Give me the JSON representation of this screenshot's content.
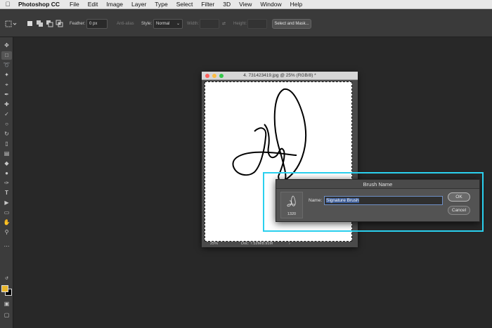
{
  "menubar": {
    "apple": "",
    "app_name": "Photoshop CC",
    "items": [
      "File",
      "Edit",
      "Image",
      "Layer",
      "Type",
      "Select",
      "Filter",
      "3D",
      "View",
      "Window",
      "Help"
    ]
  },
  "options_bar": {
    "feather_label": "Feather:",
    "feather_value": "0 px",
    "anti_alias_label": "Anti-alias",
    "style_label": "Style:",
    "style_value": "Normal",
    "width_label": "Width:",
    "height_label": "Height:",
    "select_mask_label": "Select and Mask..."
  },
  "document": {
    "title": "4. 731423419.jpg @ 25% (RGB/8) *",
    "zoom": "25%",
    "doc_size": "Doc: 7.52M/8.91M"
  },
  "dialog": {
    "title": "Brush Name",
    "brush_size": "1320",
    "name_label": "Name:",
    "name_value": "Signature Brush",
    "ok_label": "OK",
    "cancel_label": "Cancel"
  },
  "colors": {
    "foreground": "#e9b62b",
    "background": "#000000",
    "highlight": "#2ad0ee"
  }
}
